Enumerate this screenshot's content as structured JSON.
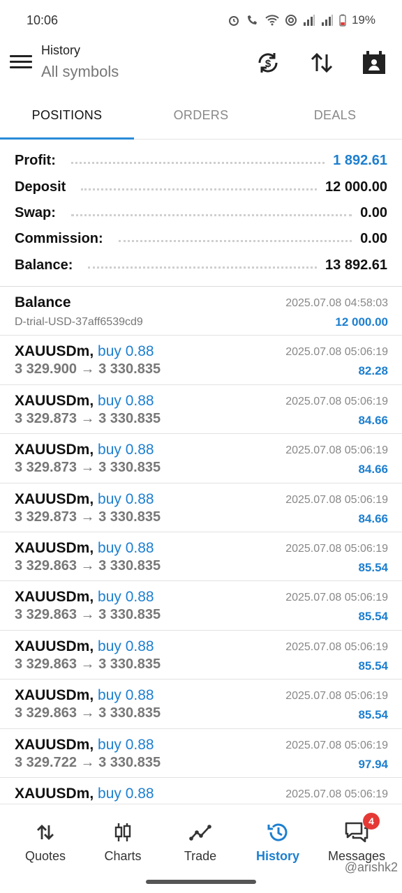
{
  "status_bar": {
    "time": "10:06",
    "battery": "19%",
    "icons": [
      "alarm-icon",
      "wifi-calling-icon",
      "wifi-icon",
      "hotspot-icon",
      "signal-icon",
      "signal-icon",
      "battery-icon"
    ]
  },
  "app_bar": {
    "title": "History",
    "subtitle": "All symbols",
    "actions": [
      "refresh-currency-icon",
      "sort-icon",
      "calendar-icon"
    ]
  },
  "tabs": [
    {
      "label": "POSITIONS",
      "active": true
    },
    {
      "label": "ORDERS",
      "active": false
    },
    {
      "label": "DEALS",
      "active": false
    }
  ],
  "summary": [
    {
      "label": "Profit:",
      "value": "1 892.61",
      "highlight": true
    },
    {
      "label": "Deposit",
      "value": "12 000.00",
      "highlight": false
    },
    {
      "label": "Swap:",
      "value": "0.00",
      "highlight": false
    },
    {
      "label": "Commission:",
      "value": "0.00",
      "highlight": false
    },
    {
      "label": "Balance:",
      "value": "13 892.61",
      "highlight": false
    }
  ],
  "balance_entry": {
    "title": "Balance",
    "comment": "D-trial-USD-37aff6539cd9",
    "time": "2025.07.08 04:58:03",
    "amount": "12 000.00"
  },
  "deals": [
    {
      "symbol": "XAUUSDm,",
      "type": "buy 0.88",
      "prices": "3 329.900 → 3 330.835",
      "time": "2025.07.08 05:06:19",
      "profit": "82.28"
    },
    {
      "symbol": "XAUUSDm,",
      "type": "buy 0.88",
      "prices": "3 329.873 → 3 330.835",
      "time": "2025.07.08 05:06:19",
      "profit": "84.66"
    },
    {
      "symbol": "XAUUSDm,",
      "type": "buy 0.88",
      "prices": "3 329.873 → 3 330.835",
      "time": "2025.07.08 05:06:19",
      "profit": "84.66"
    },
    {
      "symbol": "XAUUSDm,",
      "type": "buy 0.88",
      "prices": "3 329.873 → 3 330.835",
      "time": "2025.07.08 05:06:19",
      "profit": "84.66"
    },
    {
      "symbol": "XAUUSDm,",
      "type": "buy 0.88",
      "prices": "3 329.863 → 3 330.835",
      "time": "2025.07.08 05:06:19",
      "profit": "85.54"
    },
    {
      "symbol": "XAUUSDm,",
      "type": "buy 0.88",
      "prices": "3 329.863 → 3 330.835",
      "time": "2025.07.08 05:06:19",
      "profit": "85.54"
    },
    {
      "symbol": "XAUUSDm,",
      "type": "buy 0.88",
      "prices": "3 329.863 → 3 330.835",
      "time": "2025.07.08 05:06:19",
      "profit": "85.54"
    },
    {
      "symbol": "XAUUSDm,",
      "type": "buy 0.88",
      "prices": "3 329.863 → 3 330.835",
      "time": "2025.07.08 05:06:19",
      "profit": "85.54"
    },
    {
      "symbol": "XAUUSDm,",
      "type": "buy 0.88",
      "prices": "3 329.722 → 3 330.835",
      "time": "2025.07.08 05:06:19",
      "profit": "97.94"
    },
    {
      "symbol": "XAUUSDm,",
      "type": "buy 0.88",
      "prices": "",
      "time": "2025.07.08 05:06:19",
      "profit": ""
    }
  ],
  "bottom_nav": [
    {
      "label": "Quotes",
      "icon": "quotes-icon",
      "active": false
    },
    {
      "label": "Charts",
      "icon": "charts-icon",
      "active": false
    },
    {
      "label": "Trade",
      "icon": "trade-icon",
      "active": false
    },
    {
      "label": "History",
      "icon": "history-icon",
      "active": true
    },
    {
      "label": "Messages",
      "icon": "messages-icon",
      "active": false,
      "badge": "4"
    }
  ],
  "watermark": "@arishk2",
  "colors": {
    "accent": "#1d7fcf",
    "tab_indicator": "#2a8bd8",
    "badge": "#e53935"
  }
}
